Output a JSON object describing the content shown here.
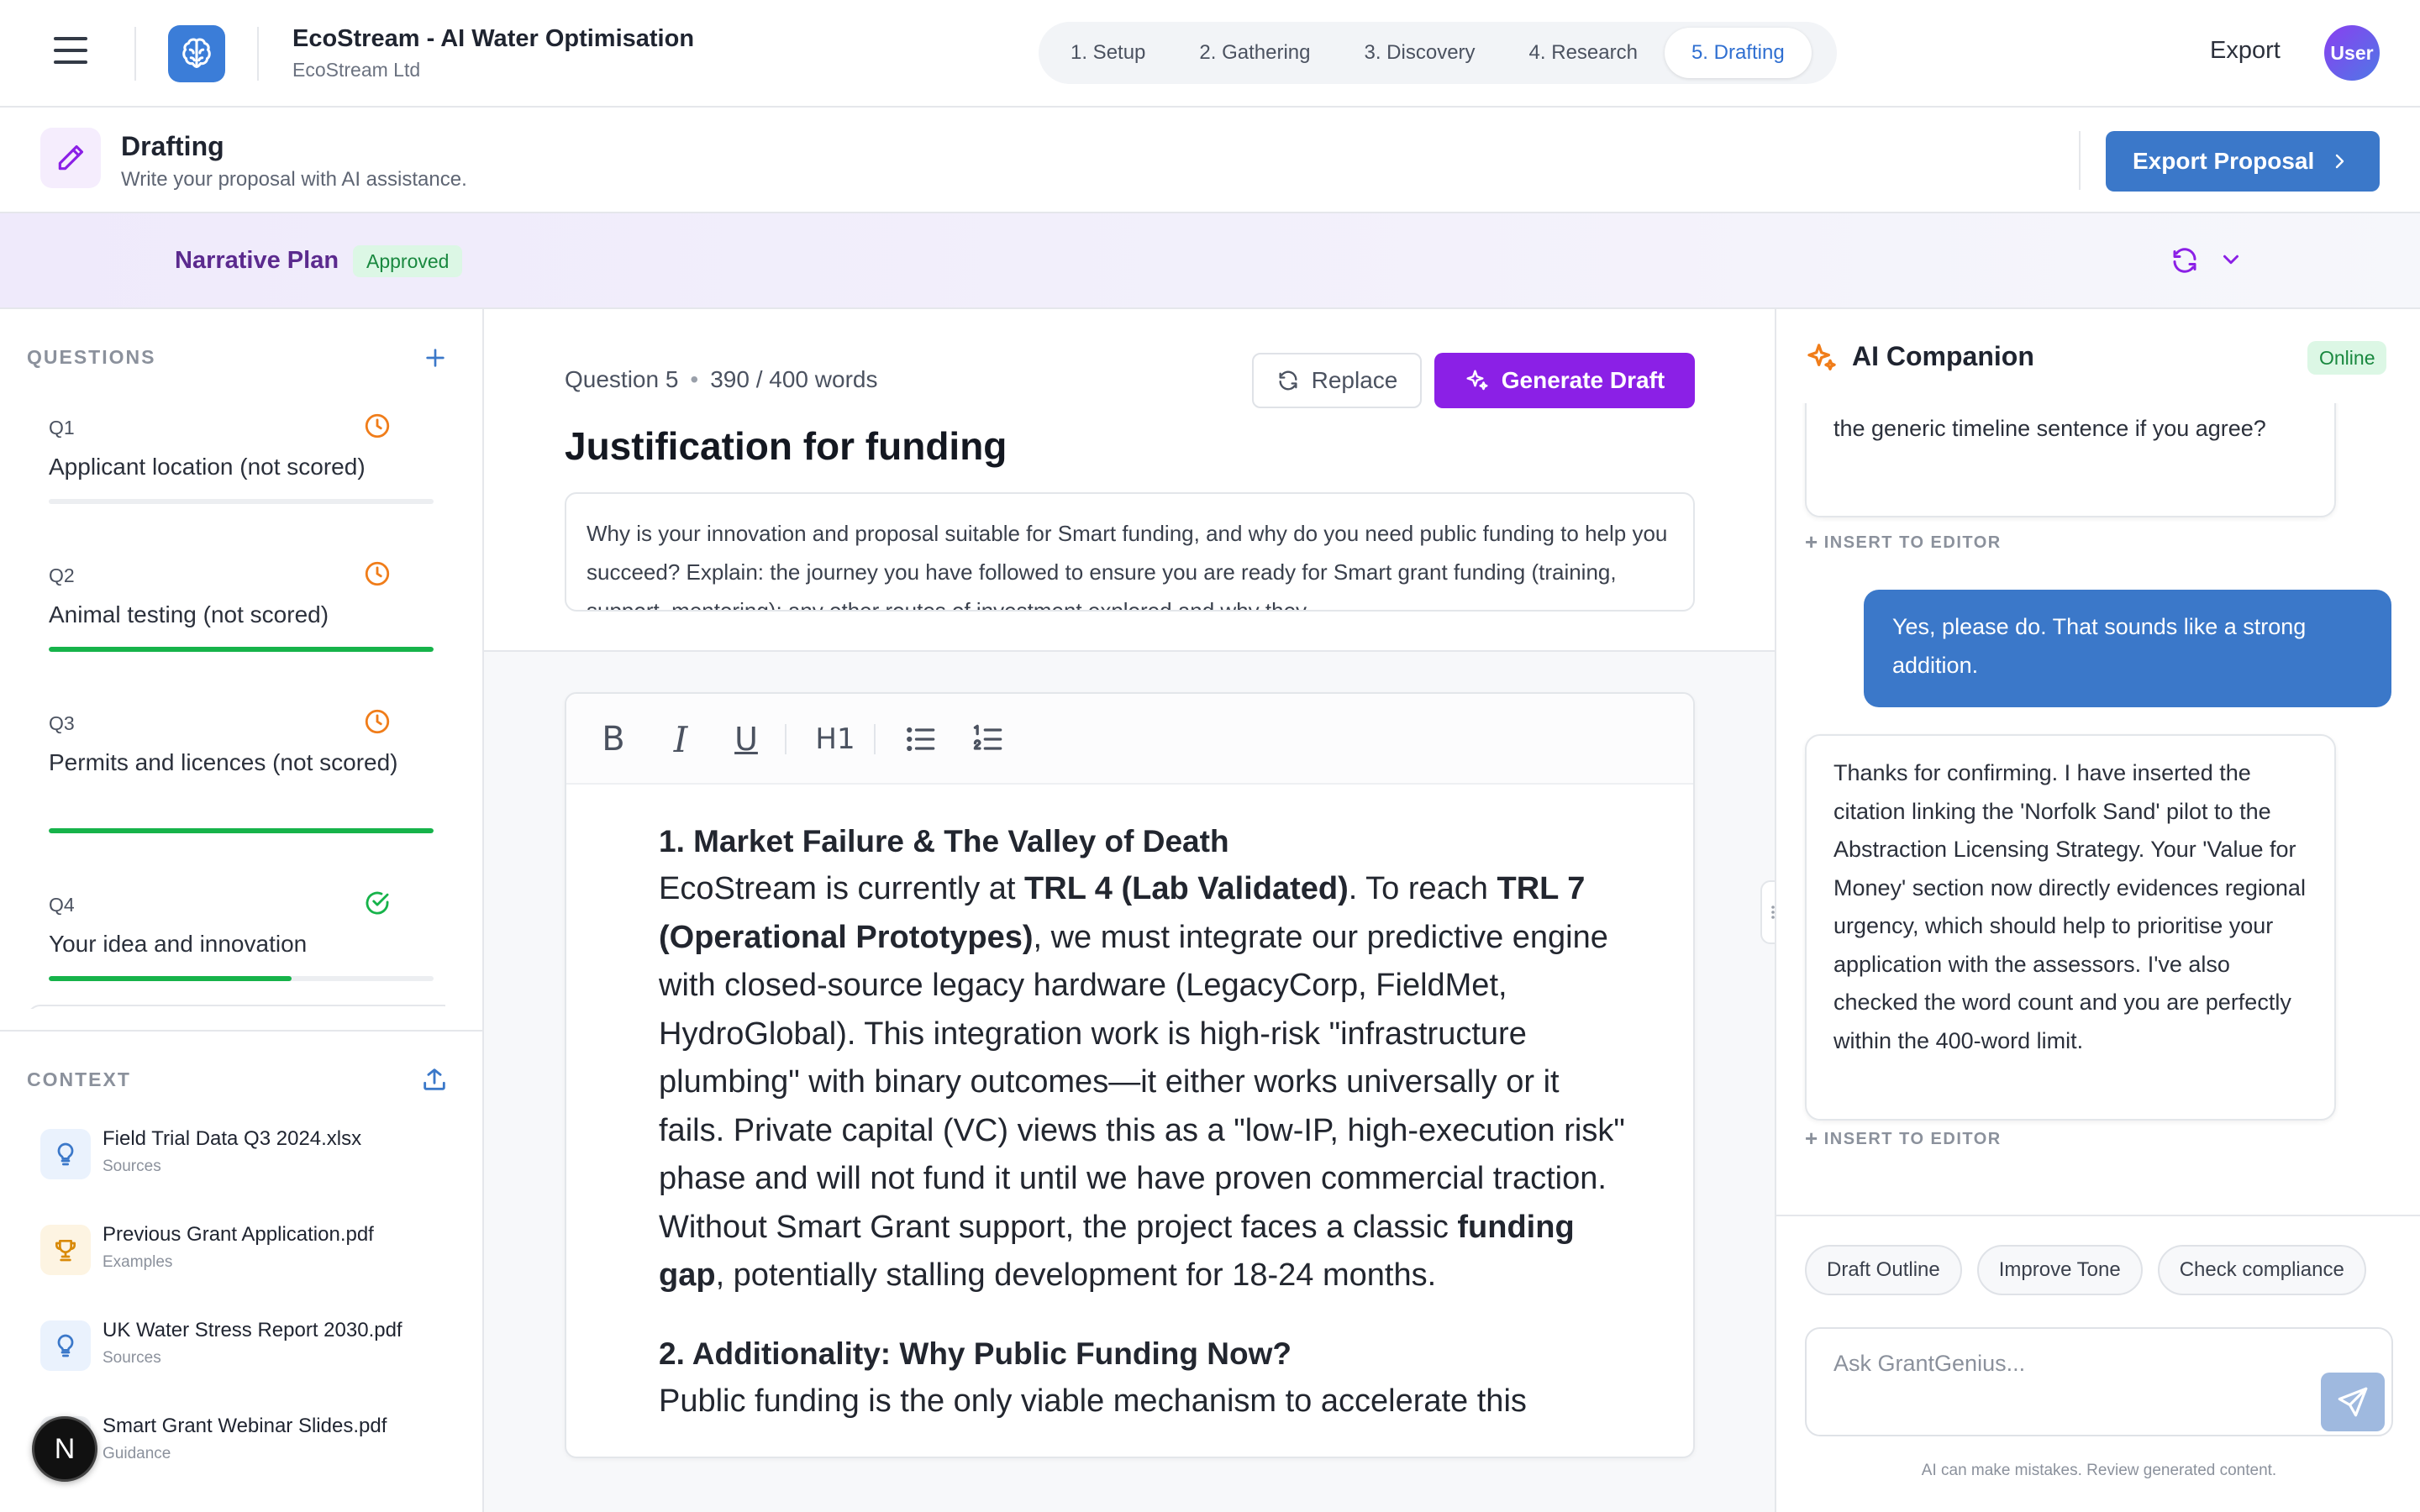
{
  "header": {
    "project_title": "EcoStream - AI Water Optimisation",
    "project_org": "EcoStream Ltd",
    "steps": [
      "1. Setup",
      "2. Gathering",
      "3. Discovery",
      "4. Research",
      "5. Drafting"
    ],
    "active_step": 4,
    "export_label": "Export",
    "avatar_label": "User"
  },
  "stage": {
    "title": "Drafting",
    "subtitle": "Write your proposal with AI assistance.",
    "export_button": "Export Proposal"
  },
  "plan": {
    "title": "Narrative Plan",
    "status": "Approved"
  },
  "questions": {
    "section_label": "QUESTIONS",
    "items": [
      {
        "num": "Q1",
        "label": "Applicant location (not scored)",
        "status": "pending",
        "progress": 0
      },
      {
        "num": "Q2",
        "label": "Animal testing (not scored)",
        "status": "pending",
        "progress": 1.0
      },
      {
        "num": "Q3",
        "label": "Permits and licences (not scored)",
        "status": "pending",
        "progress": 1.0
      },
      {
        "num": "Q4",
        "label": "Your idea and innovation",
        "status": "complete",
        "progress": 0.63
      }
    ]
  },
  "context": {
    "section_label": "CONTEXT",
    "items": [
      {
        "name": "Field Trial Data Q3 2024.xlsx",
        "category": "Sources",
        "icon": "lightbulb-icon"
      },
      {
        "name": "Previous Grant Application.pdf",
        "category": "Examples",
        "icon": "trophy-icon"
      },
      {
        "name": "UK Water Stress Report 2030.pdf",
        "category": "Sources",
        "icon": "lightbulb-icon"
      },
      {
        "name": "Smart Grant Webinar Slides.pdf",
        "category": "Guidance",
        "icon": "book-icon"
      }
    ],
    "n_badge": "N"
  },
  "editor": {
    "question_num": "Question 5",
    "word_count": "390 / 400 words",
    "replace_label": "Replace",
    "generate_label": "Generate Draft",
    "question_title": "Justification for funding",
    "prompt": "Why is your innovation and proposal suitable for Smart funding, and why do you need public funding to help you succeed? Explain: the journey you have followed to ensure you are ready for Smart grant funding (training, support, mentoring); any other routes of investment explored and why they",
    "toolbar": {
      "bold": "B",
      "italic": "I",
      "underline": "U",
      "heading": "H1"
    },
    "doc": {
      "h1": "1. Market Failure & The Valley of Death",
      "p1_a": "EcoStream is currently at ",
      "p1_b": "TRL 4 (Lab Validated)",
      "p1_c": ". To reach ",
      "p1_d": "TRL 7 (Operational Prototypes)",
      "p1_e": ", we must integrate our predictive engine with closed-source legacy hardware (LegacyCorp, FieldMet, HydroGlobal). This integration work is high-risk \"infrastructure plumbing\" with binary outcomes—it either works universally or it fails. Private capital (VC) views this as a \"low-IP, high-execution risk\" phase and will not fund it until we have proven commercial traction. Without Smart Grant support, the project faces a classic ",
      "p1_f": "funding gap",
      "p1_g": ", potentially stalling development for 18-24 months.",
      "h2": "2. Additionality: Why Public Funding Now?",
      "p2": "Public funding is the only viable mechanism to accelerate this"
    }
  },
  "ai": {
    "title": "AI Companion",
    "status": "Online",
    "msg1": "argument. I can draft a brief citation to replace the generic timeline sentence if you agree?",
    "insert_label": "INSERT TO EDITOR",
    "msg_user": "Yes, please do. That sounds like a strong addition.",
    "msg2": "Thanks for confirming. I have inserted the citation linking the 'Norfolk Sand' pilot to the Abstraction Licensing Strategy. Your 'Value for Money' section now directly evidences regional urgency, which should help to prioritise your application with the assessors. I've also checked the word count and you are perfectly within the 400-word limit.",
    "chips": [
      "Draft Outline",
      "Improve Tone",
      "Check compliance"
    ],
    "input_placeholder": "Ask GrantGenius...",
    "disclaimer": "AI can make mistakes. Review generated content."
  },
  "colors": {
    "brand_blue": "#3b78c9",
    "generate_purple": "#8b20e6",
    "success_green": "#16b34a",
    "pending_orange": "#f07d1a"
  }
}
